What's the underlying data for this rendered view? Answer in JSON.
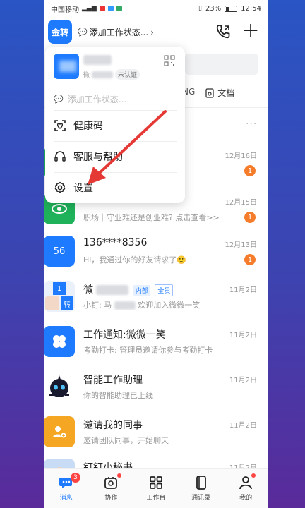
{
  "statusbar": {
    "carrier": "中国移动",
    "battery": "23%",
    "time": "12:54"
  },
  "topbar": {
    "switch_label": "金转",
    "status_text": "添加工作状态..."
  },
  "background": {
    "tab_partial": "NG",
    "tab_doc": "文档",
    "more": "···"
  },
  "popup": {
    "sub_prefix": "微",
    "verify_badge": "未认证",
    "status_placeholder": "添加工作状态...",
    "menu": [
      {
        "label": "健康码",
        "icon": "health-code-icon"
      },
      {
        "label": "客服与帮助",
        "icon": "headset-icon"
      },
      {
        "label": "设置",
        "icon": "gear-icon"
      }
    ]
  },
  "chats": [
    {
      "title": "",
      "subtitle": "",
      "date": "12月16日",
      "badge": "1",
      "avatar_color": "#1fb25a"
    },
    {
      "title": "",
      "subtitle": "职场｜守业难还是创业难? 点击查看>>",
      "date": "12月15日",
      "badge": "1",
      "avatar_color": "#1fb25a"
    },
    {
      "title": "136****8356",
      "subtitle": "Hi，我通过你的好友请求了🙂",
      "date": "12月13日",
      "badge": "1",
      "avatar_text": "56",
      "avatar_color": "#1e7bff"
    },
    {
      "title": "微",
      "tag1": "内部",
      "tag2": "全员",
      "subtitle_prefix": "小钉: 马",
      "subtitle": "欢迎加入微微一笑",
      "date": "11月2日",
      "avatar_color": "#1e7bff"
    },
    {
      "title": "工作通知:微微一笑",
      "subtitle": "考勤打卡: 管理员邀请你参与考勤打卡",
      "date": "11月2日",
      "avatar_color": "#1e7bff"
    },
    {
      "title": "智能工作助理",
      "subtitle": "你的智能助理已上线",
      "date": "11月2日",
      "avatar_color": "#1a1a2e"
    },
    {
      "title": "邀请我的同事",
      "subtitle": "邀请团队同事，开始聊天",
      "date": "11月2日",
      "avatar_color": "#f5a623"
    },
    {
      "title": "钉钉小秘书",
      "subtitle": "",
      "date": "11月2日",
      "avatar_color": "#c9dcf5"
    }
  ],
  "chat_avatar_text": {
    "badge_1": "1",
    "badge_2": "转"
  },
  "bottomnav": {
    "items": [
      {
        "label": "消息",
        "badge": "3"
      },
      {
        "label": "协作"
      },
      {
        "label": "工作台"
      },
      {
        "label": "通讯录"
      },
      {
        "label": "我的"
      }
    ]
  },
  "colors": {
    "accent": "#1e7bff",
    "badge": "#f57c2a",
    "annotation": "#e53935"
  }
}
